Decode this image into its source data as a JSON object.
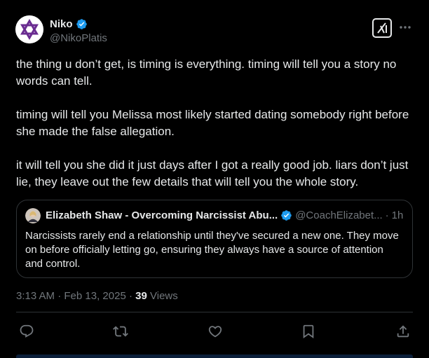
{
  "author": {
    "name": "Niko",
    "handle": "@NikoPlatis",
    "avatar_icon": "star-of-david-icon",
    "verified_color": "#1d9bf0"
  },
  "header_actions": {
    "grok_icon": "grok-icon",
    "more_icon": "more-dots-icon"
  },
  "tweet": {
    "paragraphs": [
      "the thing u don’t get, is timing is everything. timing will tell you a story no words can tell.",
      "timing will tell you Melissa most likely started dating somebody right before she made the false allegation.",
      "it will tell you she did it just days after I got a really good job. liars don’t just lie, they leave out the few details that will tell you the whole story."
    ]
  },
  "quote": {
    "name": "Elizabeth Shaw - Overcoming Narcissist Abu...",
    "handle": "@CoachElizabet...",
    "dot": "·",
    "time": "1h",
    "text": "Narcissists rarely end a relationship until they've secured a new one. They move on before officially letting go, ensuring they always have a source of attention and control."
  },
  "meta": {
    "time": "3:13 AM",
    "sep1": "·",
    "date": "Feb 13, 2025",
    "sep2": "·",
    "views_count": "39",
    "views_label": "Views"
  },
  "actions": {
    "reply_icon": "reply-icon",
    "retweet_icon": "retweet-icon",
    "like_icon": "heart-icon",
    "bookmark_icon": "bookmark-icon",
    "share_icon": "share-icon"
  },
  "colors": {
    "background": "#000000",
    "text_primary": "#e7e9ea",
    "text_secondary": "#71767b",
    "border": "#2f3336",
    "accent": "#1d9bf0"
  }
}
